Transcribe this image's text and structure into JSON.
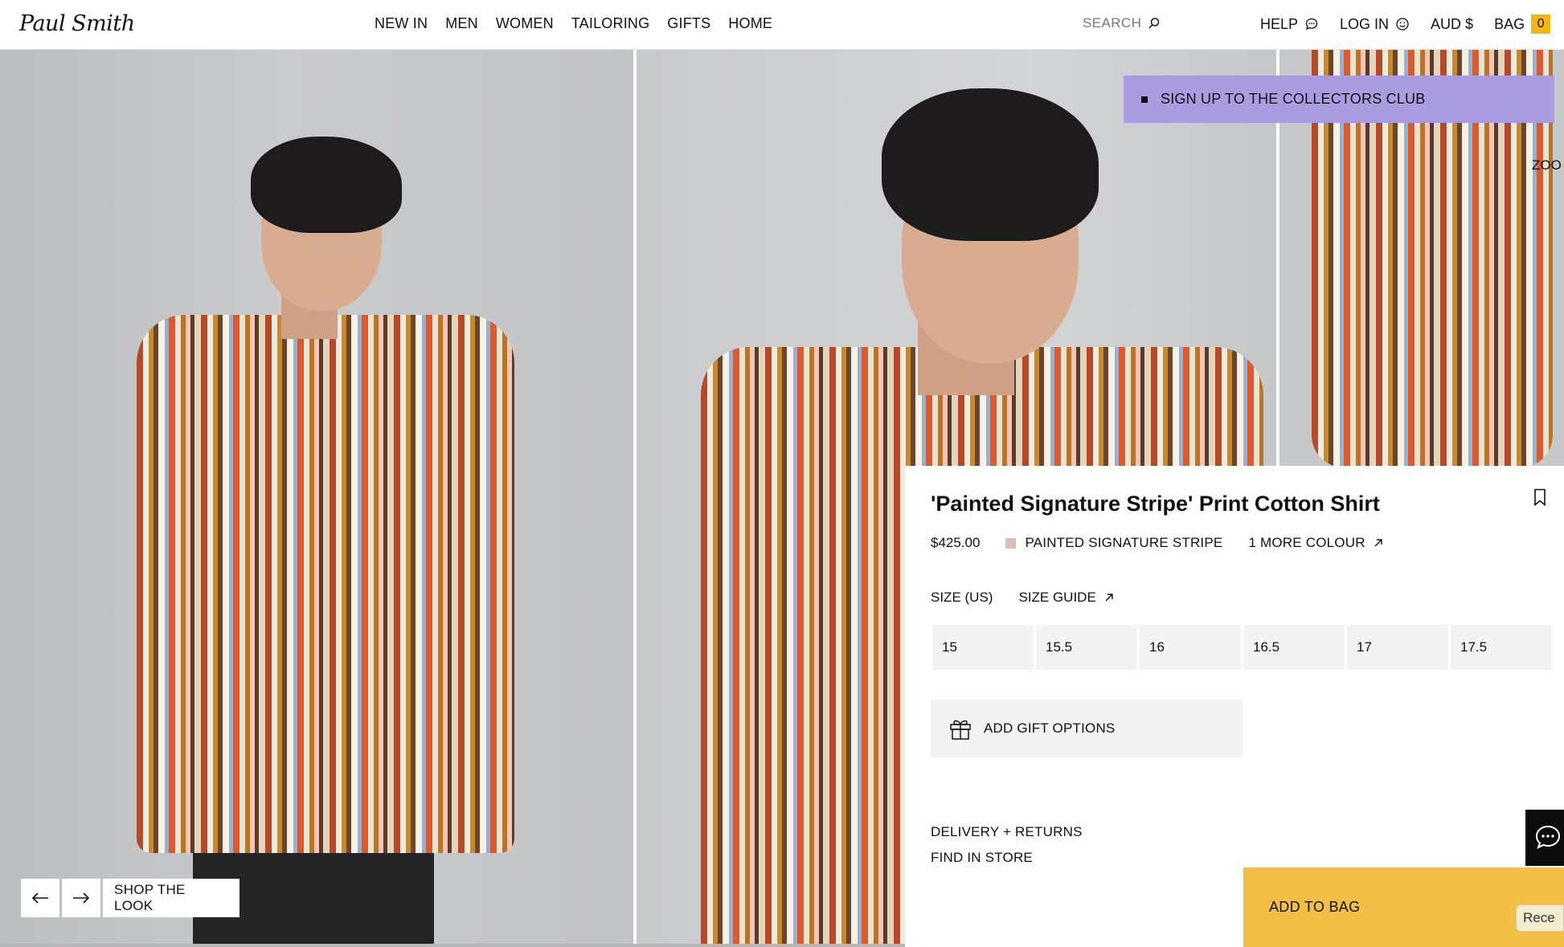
{
  "header": {
    "logo": "Paul Smith",
    "nav": [
      "NEW IN",
      "MEN",
      "WOMEN",
      "TAILORING",
      "GIFTS",
      "HOME"
    ],
    "search_label": "SEARCH",
    "help_label": "HELP",
    "login_label": "LOG IN",
    "currency_label": "AUD $",
    "bag_label": "BAG",
    "bag_count": "0"
  },
  "gallery": {
    "shop_the_look_label": "SHOP THE LOOK",
    "signup_banner": "SIGN UP TO THE COLLECTORS CLUB",
    "zoom_label": "ZOO"
  },
  "product": {
    "title": "'Painted Signature Stripe' Print Cotton Shirt",
    "price": "$425.00",
    "colour_name": "PAINTED SIGNATURE STRIPE",
    "more_colour": "1 MORE COLOUR",
    "size_label": "SIZE (US)",
    "size_guide": "SIZE GUIDE",
    "sizes": [
      "15",
      "15.5",
      "16",
      "16.5",
      "17",
      "17.5"
    ],
    "gift_options": "ADD GIFT OPTIONS",
    "delivery_returns": "DELIVERY + RETURNS",
    "find_in_store": "FIND IN STORE",
    "add_to_bag": "ADD TO BAG"
  },
  "chat": {
    "recent_label": "Rece"
  },
  "colors": {
    "accent_yellow": "#f2be44",
    "banner_lavender": "#a99ce0",
    "bag_badge": "#f2b619",
    "swatch": "#d9c1b7"
  }
}
